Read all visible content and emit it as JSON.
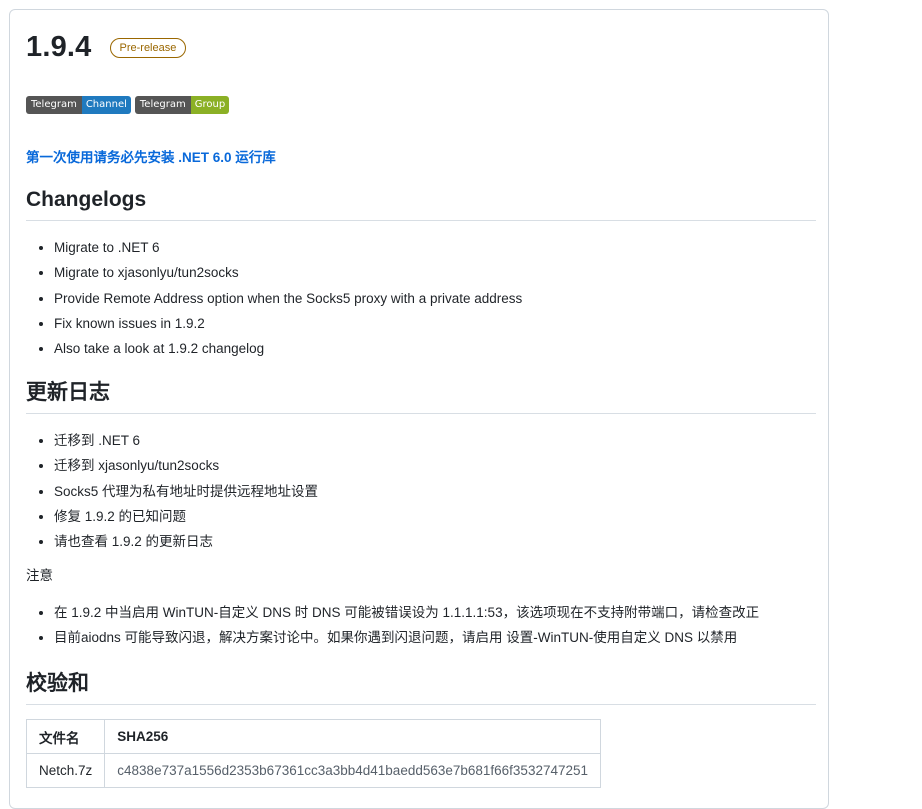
{
  "release": {
    "version": "1.9.4",
    "badge": "Pre-release"
  },
  "social_badges": [
    {
      "left": "Telegram",
      "right": "Channel",
      "color": "#1f7abf"
    },
    {
      "left": "Telegram",
      "right": "Group",
      "color": "#8bb025"
    }
  ],
  "notice_link": "第一次使用请务必先安装 .NET 6.0 运行库",
  "changelog_en": {
    "heading": "Changelogs",
    "items": [
      "Migrate to .NET 6",
      "Migrate to xjasonlyu/tun2socks",
      "Provide Remote Address option when the Socks5 proxy with a private address",
      "Fix known issues in 1.9.2",
      "Also take a look at 1.9.2 changelog"
    ]
  },
  "changelog_zh": {
    "heading": "更新日志",
    "items": [
      "迁移到 .NET 6",
      "迁移到 xjasonlyu/tun2socks",
      "Socks5 代理为私有地址时提供远程地址设置",
      "修复 1.9.2 的已知问题",
      "请也查看 1.9.2 的更新日志"
    ]
  },
  "notes": {
    "label": "注意",
    "items": [
      "在 1.9.2 中当启用 WinTUN-自定义 DNS 时 DNS 可能被错误设为 1.1.1.1:53，该选项现在不支持附带端口，请检查改正",
      "目前aiodns 可能导致闪退，解决方案讨论中。如果你遇到闪退问题，请启用 设置-WinTUN-使用自定义 DNS 以禁用"
    ]
  },
  "checksum": {
    "heading": "校验和",
    "columns": [
      "文件名",
      "SHA256"
    ],
    "rows": [
      [
        "Netch.7z",
        "c4838e737a1556d2353b67361cc3a3bb4d41baedd563e7b681f66f3532747251"
      ]
    ]
  },
  "colors": {
    "link": "#0969da",
    "prerelease": "#9a6700",
    "text": "#1f2328"
  }
}
